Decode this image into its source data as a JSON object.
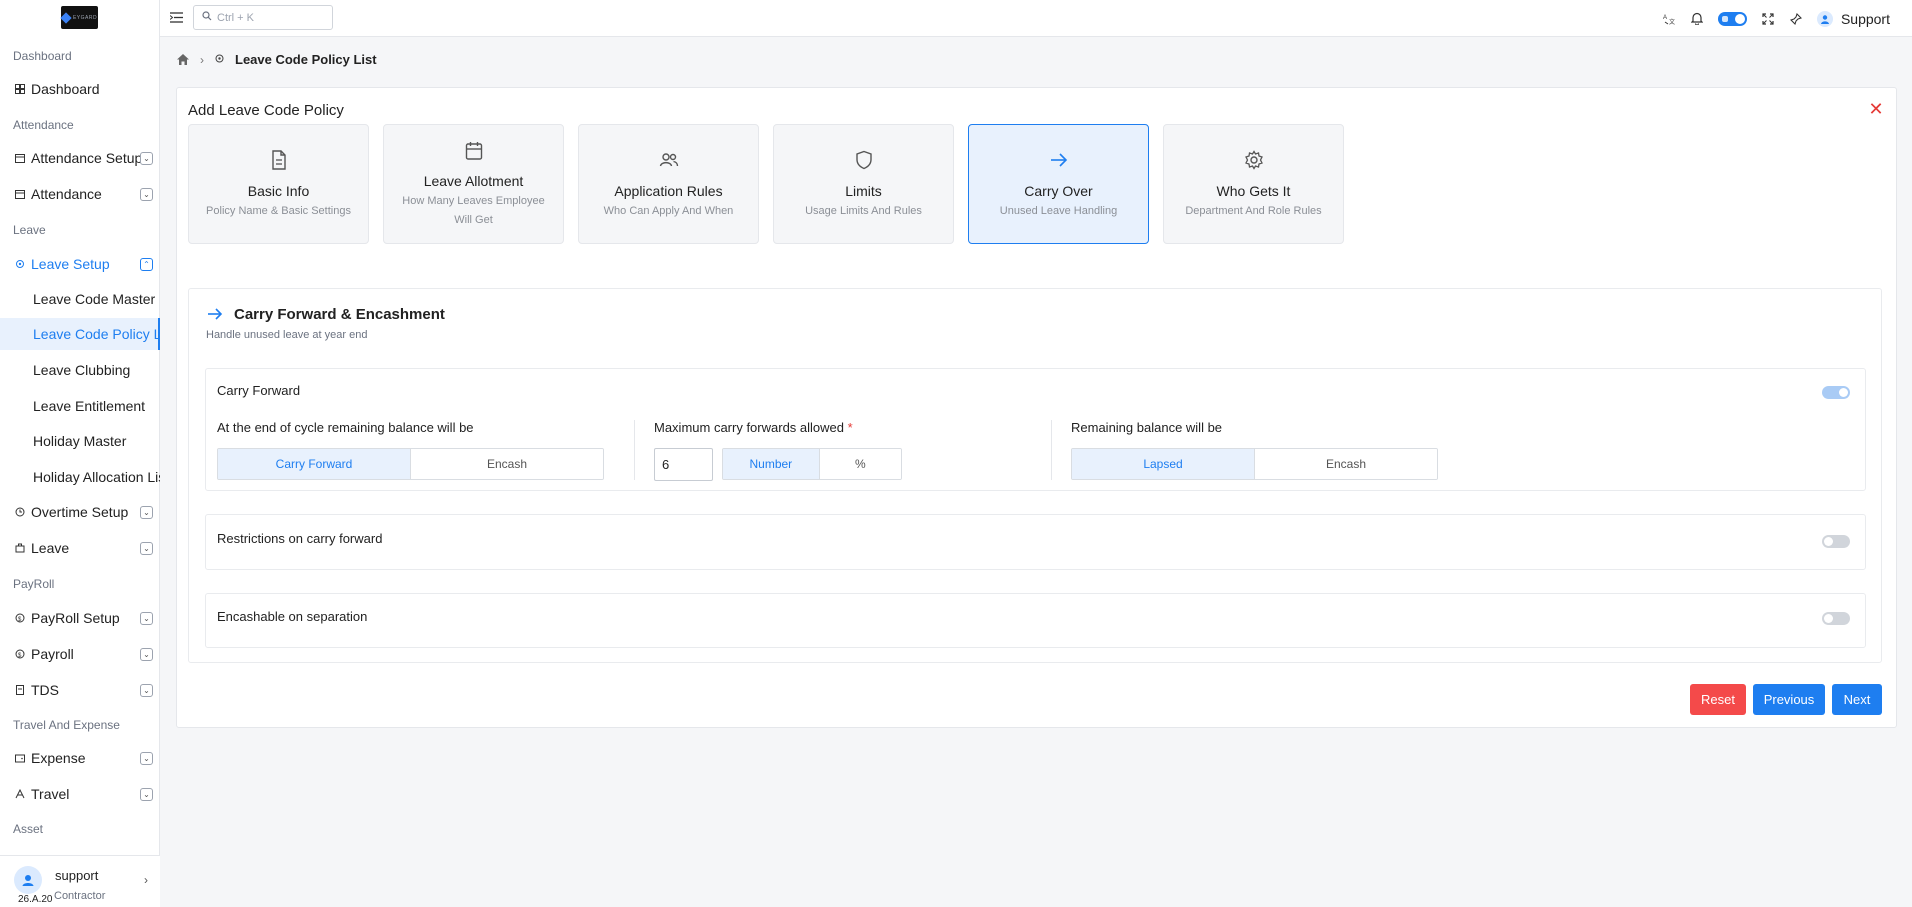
{
  "sidebar": {
    "logo_text": "EYGARD",
    "sections": {
      "dashboard": "Dashboard",
      "attendance": "Attendance",
      "leave": "Leave",
      "payroll": "PayRoll",
      "travel": "Travel And Expense",
      "asset": "Asset"
    },
    "items": {
      "dashboard": "Dashboard",
      "attendance_setup": "Attendance Setup",
      "attendance": "Attendance",
      "leave_setup": "Leave Setup",
      "overtime_setup": "Overtime Setup",
      "leave": "Leave",
      "payroll_setup": "PayRoll Setup",
      "payroll": "Payroll",
      "tds": "TDS",
      "expense": "Expense",
      "travel": "Travel"
    },
    "leave_subitems": [
      "Leave Code Master",
      "Leave Code Policy List",
      "Leave Clubbing",
      "Leave Entitlement",
      "Holiday Master",
      "Holiday Allocation List"
    ],
    "footer": {
      "name": "support",
      "role": "Contractor",
      "version": "26.A.20"
    }
  },
  "topbar": {
    "search_placeholder": "Ctrl + K",
    "user_name": "Support"
  },
  "breadcrumb": {
    "current": "Leave Code Policy List"
  },
  "page": {
    "title": "Add Leave Code Policy",
    "steps": [
      {
        "title": "Basic Info",
        "desc": "Policy Name & Basic Settings",
        "icon": "document-icon"
      },
      {
        "title": "Leave Allotment",
        "desc": "How Many Leaves Employee Will Get",
        "icon": "calendar-icon"
      },
      {
        "title": "Application Rules",
        "desc": "Who Can Apply And When",
        "icon": "users-icon"
      },
      {
        "title": "Limits",
        "desc": "Usage Limits And Rules",
        "icon": "shield-icon"
      },
      {
        "title": "Carry Over",
        "desc": "Unused Leave Handling",
        "icon": "arrow-right-icon"
      },
      {
        "title": "Who Gets It",
        "desc": "Department And Role Rules",
        "icon": "gear-icon"
      }
    ],
    "active_step": 4
  },
  "section": {
    "title": "Carry Forward & Encashment",
    "subtitle": "Handle unused leave at year end",
    "carry_forward": {
      "label": "Carry Forward",
      "enabled": true,
      "col1_label": "At the end of cycle remaining balance will be",
      "col1_options": [
        "Carry Forward",
        "Encash"
      ],
      "col2_label": "Maximum carry forwards allowed",
      "col2_required": "*",
      "col2_value": "6",
      "col2_options": [
        "Number",
        "%"
      ],
      "col3_label": "Remaining balance will be",
      "col3_options": [
        "Lapsed",
        "Encash"
      ]
    },
    "restrictions": {
      "label": "Restrictions on carry forward",
      "enabled": false
    },
    "encashable": {
      "label": "Encashable on separation",
      "enabled": false
    }
  },
  "actions": {
    "reset": "Reset",
    "previous": "Previous",
    "next": "Next"
  },
  "colors": {
    "accent": "#1e7ef0",
    "danger": "#f44a4a"
  }
}
